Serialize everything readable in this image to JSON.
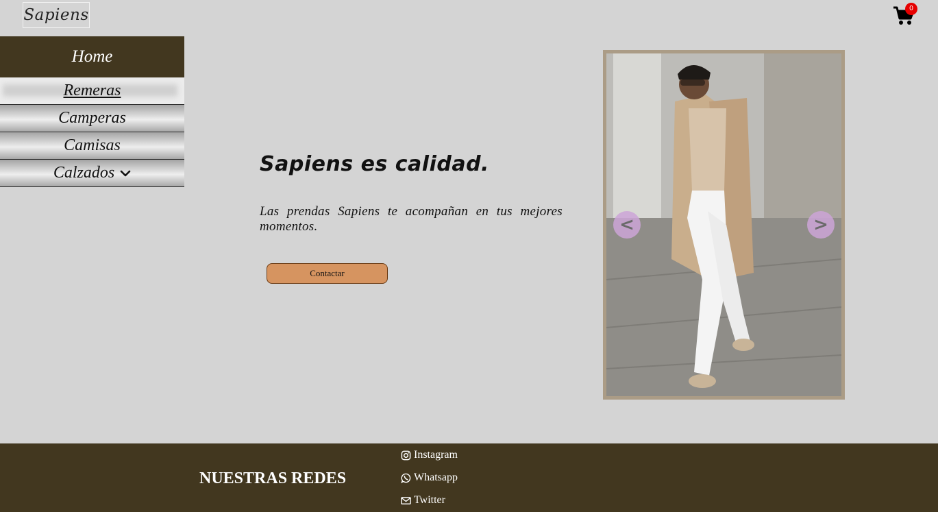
{
  "header": {
    "logo_text": "Sapiens",
    "cart_count": "0",
    "icons": {
      "cart": "shopping-cart-icon"
    },
    "colors": {
      "badge": "#e60000"
    }
  },
  "sidebar": {
    "items": [
      {
        "label": "Home",
        "state": "highlighted"
      },
      {
        "label": "Remeras",
        "state": "active"
      },
      {
        "label": "Camperas",
        "state": "normal"
      },
      {
        "label": "Camisas",
        "state": "normal"
      },
      {
        "label": "Calzados",
        "state": "dropdown"
      }
    ],
    "colors": {
      "home_bg": "#42371f"
    }
  },
  "hero": {
    "title": "Sapiens es calidad.",
    "text": "Las prendas Sapiens te acompañan en tus mejores momentos.",
    "button_label": "Contactar",
    "colors": {
      "button": "#d69460"
    }
  },
  "carousel": {
    "prev_label": "<",
    "next_label": ">",
    "colors": {
      "frame": "#ab9c86",
      "arrow": "#cda5d7"
    }
  },
  "footer": {
    "title": "NUESTRAS REDES",
    "links": [
      {
        "label": "Instagram",
        "icon": "instagram-icon"
      },
      {
        "label": "Whatsapp",
        "icon": "whatsapp-icon"
      },
      {
        "label": "Twitter",
        "icon": "envelope-icon"
      }
    ],
    "colors": {
      "background": "#42371f"
    }
  }
}
